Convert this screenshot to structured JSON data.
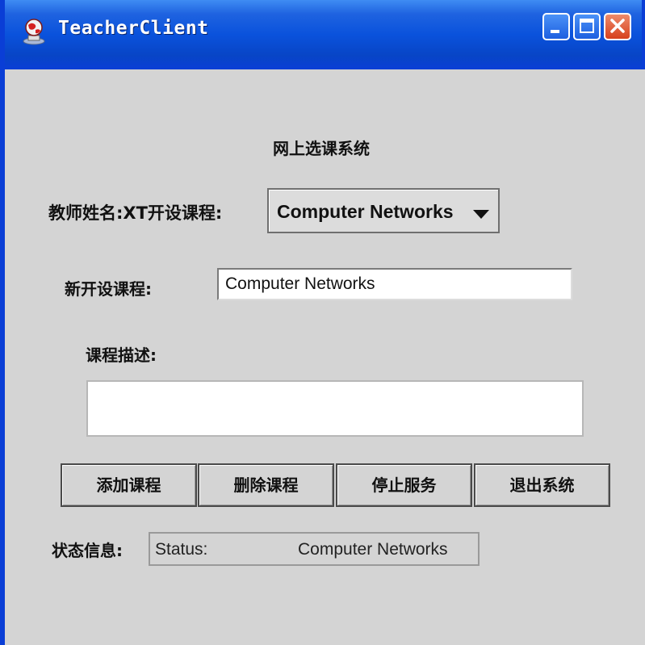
{
  "window": {
    "title": "TeacherClient",
    "icon": "app-globe-icon",
    "controls": [
      "minimize-icon",
      "maximize-icon",
      "close-icon"
    ]
  },
  "form": {
    "heading": "网上选课系统",
    "teacher_label": "教师姓名:XT开设课程:",
    "course_select": {
      "selected": "Computer Networks"
    },
    "new_course_label": "新开设课程:",
    "new_course_value": "Computer Networks",
    "description_label": "课程描述:",
    "description_value": ""
  },
  "buttons": {
    "add": "添加课程",
    "delete": "删除课程",
    "stop": "停止服务",
    "exit": "退出系统"
  },
  "status": {
    "label": "状态信息:",
    "prefix": "Status:",
    "value": "Computer Networks"
  },
  "colors": {
    "titlebar": "#0a52dc",
    "window_bg": "#d4d4d4",
    "close_button": "#d6401c"
  }
}
